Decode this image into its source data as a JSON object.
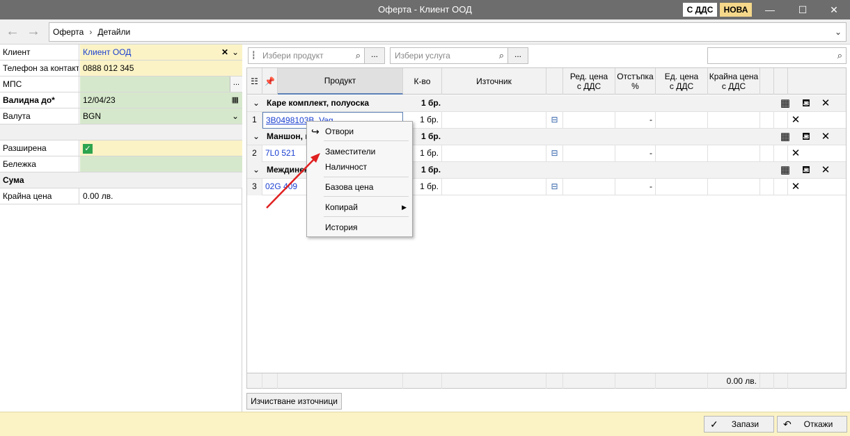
{
  "window": {
    "title": "Оферта - Клиент ООД",
    "vat_badge": "С ДДС",
    "status_badge": "НОВА",
    "minimize": "—",
    "maximize": "☐",
    "close": "✕"
  },
  "nav": {
    "back": "←",
    "forward": "→",
    "breadcrumb": [
      "Оферта",
      "Детайли"
    ],
    "breadcrumb_sep": "›",
    "dropdown": "⌄"
  },
  "form": {
    "client_label": "Клиент",
    "client_value": "Клиент ООД",
    "contact_phone_label": "Телефон за контакт",
    "contact_phone_value": "0888 012 345",
    "mps_label": "МПС",
    "mps_value": "",
    "valid_until_label": "Валидна до*",
    "valid_until_value": "12/04/23",
    "currency_label": "Валута",
    "currency_value": "BGN",
    "extended_label": "Разширена",
    "extended_checked": true,
    "note_label": "Бележка",
    "note_value": "",
    "sum_section": "Сума",
    "final_price_label": "Крайна цена",
    "final_price_value": "0.00 лв."
  },
  "search": {
    "product_placeholder": "Избери продукт",
    "service_placeholder": "Избери услуга",
    "global_placeholder": "",
    "ellipsis": "..."
  },
  "grid": {
    "columns": [
      "Продукт",
      "К-во",
      "Източник",
      "Ред. цена\nс ДДС",
      "Отстъпка\n%",
      "Ед. цена\nс ДДС",
      "Крайна цена\nс ДДС"
    ],
    "col_product": "Продукт",
    "col_qty": "К-во",
    "col_source": "Източник",
    "col_row_price": "Ред. цена с ДДС",
    "col_discount": "Отстъпка %",
    "col_unit_price": "Ед. цена с ДДС",
    "col_final_price": "Крайна цена с ДДС",
    "groups": [
      {
        "name": "Каре комплект, полуоска",
        "qty": "1 бр.",
        "row_no": "1",
        "item": "3B0498103B, Vag",
        "item_qty": "1 бр.",
        "discount": "-"
      },
      {
        "name": "Маншон, п",
        "qty": "1 бр.",
        "row_no": "2",
        "item": "7L0 521",
        "item_qty": "1 бр.",
        "discount": "-"
      },
      {
        "name": "Междинен",
        "qty": "1 бр.",
        "row_no": "3",
        "item": "02G 409",
        "item_qty": "1 бр.",
        "discount": "-"
      }
    ],
    "footer_total": "0.00 лв."
  },
  "context_menu": {
    "open": "Отвори",
    "substitutes": "Заместители",
    "availability": "Наличност",
    "base_price": "Базова цена",
    "copy": "Копирай",
    "history": "История"
  },
  "buttons": {
    "clear_sources": "Изчистване източници",
    "save": "Запази",
    "cancel": "Откажи"
  },
  "colors": {
    "titlebar": "#6d6d6d",
    "required_field": "#fbf3c6",
    "optional_field": "#d6e8cc",
    "link": "#1a3fd0",
    "annotation_arrow": "#e02020"
  }
}
